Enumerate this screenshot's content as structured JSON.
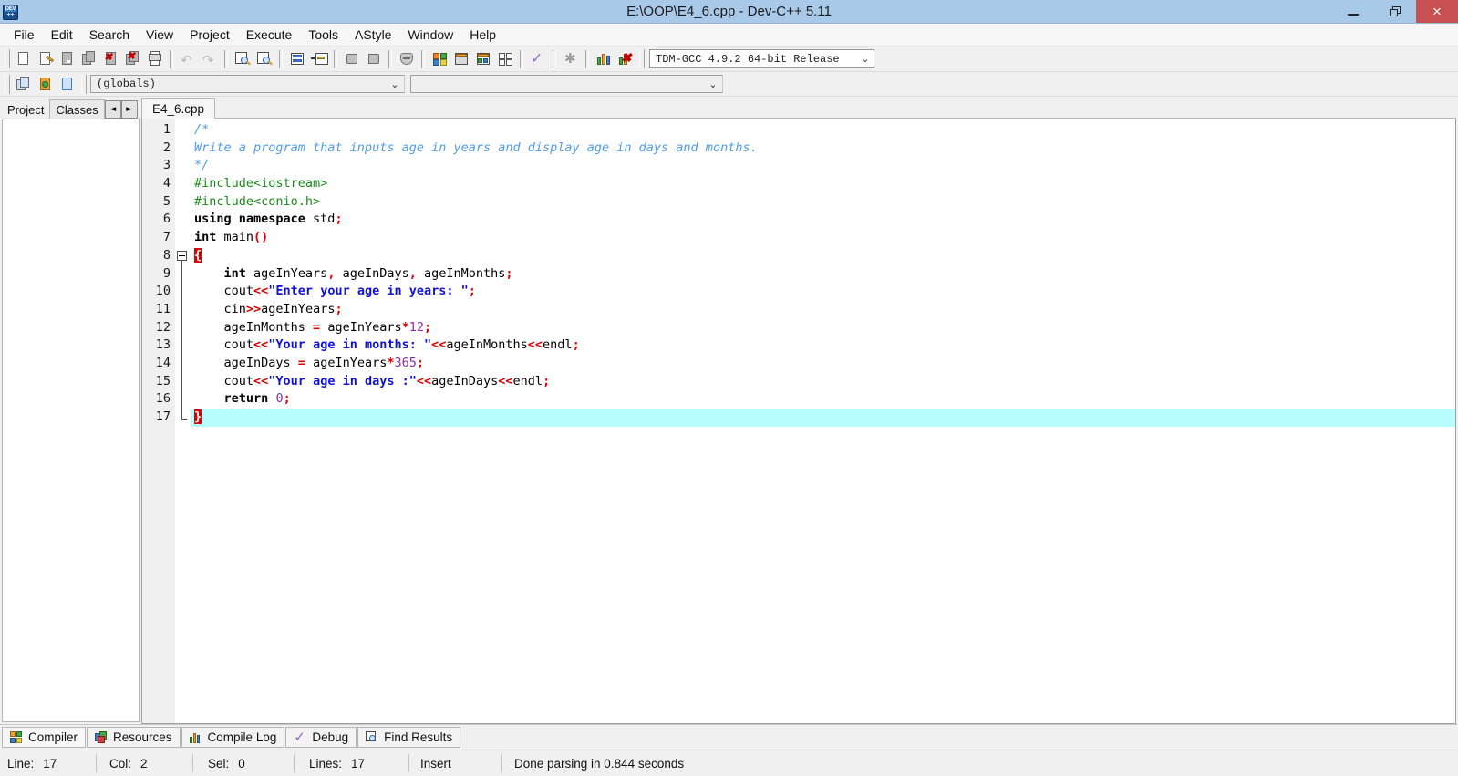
{
  "window": {
    "title": "E:\\OOP\\E4_6.cpp - Dev-C++ 5.11",
    "app_icon_top": "DEV",
    "app_icon_bottom": "++",
    "titlebar_color": "#a9c9e8",
    "close_button_color": "#c75050",
    "minimize_label": "Minimize",
    "restore_label": "Restore",
    "close_label": "×"
  },
  "menubar": {
    "items": [
      {
        "label": "File"
      },
      {
        "label": "Edit"
      },
      {
        "label": "Search"
      },
      {
        "label": "View"
      },
      {
        "label": "Project"
      },
      {
        "label": "Execute"
      },
      {
        "label": "Tools"
      },
      {
        "label": "AStyle"
      },
      {
        "label": "Window"
      },
      {
        "label": "Help"
      }
    ]
  },
  "toolbar": {
    "groups": [
      {
        "buttons": [
          {
            "icon": "new-file-icon"
          },
          {
            "icon": "open-file-icon"
          },
          {
            "icon": "save-file-icon"
          },
          {
            "icon": "save-all-icon"
          },
          {
            "icon": "close-file-icon"
          },
          {
            "icon": "close-all-icon"
          },
          {
            "icon": "print-icon"
          }
        ]
      },
      {
        "buttons": [
          {
            "icon": "undo-icon"
          },
          {
            "icon": "redo-icon"
          }
        ]
      },
      {
        "buttons": [
          {
            "icon": "find-icon"
          },
          {
            "icon": "replace-icon"
          },
          {
            "icon": "goto-line-icon"
          },
          {
            "icon": "goto-function-icon"
          }
        ]
      },
      {
        "buttons": [
          {
            "icon": "back-icon"
          },
          {
            "icon": "forward-icon"
          },
          {
            "icon": "toggle-bookmark-icon"
          }
        ]
      },
      {
        "buttons": [
          {
            "icon": "new-project-icon"
          },
          {
            "icon": "compile-icon"
          },
          {
            "icon": "run-icon"
          },
          {
            "icon": "compile-run-icon"
          },
          {
            "icon": "rebuild-all-icon"
          },
          {
            "icon": "syntax-check-icon"
          },
          {
            "icon": "stop-execution-icon"
          },
          {
            "icon": "profile-icon"
          },
          {
            "icon": "delete-profile-icon"
          }
        ]
      }
    ],
    "compiler_select": {
      "value": "TDM-GCC 4.9.2 64-bit Release",
      "arrow": "⌄"
    }
  },
  "toolbar2": {
    "buttons": [
      {
        "icon": "insert-icon"
      },
      {
        "icon": "add-to-project-icon"
      },
      {
        "icon": "toggle-panel-icon"
      }
    ],
    "scope_select": {
      "value": "(globals)",
      "arrow": "⌄"
    },
    "symbol_select": {
      "value": "",
      "arrow": "⌄"
    }
  },
  "left_panel": {
    "tabs": [
      {
        "label": "Project",
        "selected": true
      },
      {
        "label": "Classes",
        "selected": false
      }
    ],
    "scroll_left": "◄",
    "scroll_right": "►"
  },
  "editor": {
    "tabs": [
      {
        "label": "E4_6.cpp",
        "selected": true
      }
    ],
    "current_line": 17,
    "fold_start_line": 8,
    "fold_end_line": 17,
    "line_numbers": [
      1,
      2,
      3,
      4,
      5,
      6,
      7,
      8,
      9,
      10,
      11,
      12,
      13,
      14,
      15,
      16,
      17
    ],
    "lines": [
      {
        "n": 1,
        "tokens": [
          {
            "t": "/*",
            "c": "cm"
          }
        ]
      },
      {
        "n": 2,
        "tokens": [
          {
            "t": "Write a program that inputs age in years and display age in days and months.",
            "c": "cm"
          }
        ]
      },
      {
        "n": 3,
        "tokens": [
          {
            "t": "*/",
            "c": "cm"
          }
        ]
      },
      {
        "n": 4,
        "tokens": [
          {
            "t": "#include<iostream>",
            "c": "pp"
          }
        ]
      },
      {
        "n": 5,
        "tokens": [
          {
            "t": "#include<conio.h>",
            "c": "pp"
          }
        ]
      },
      {
        "n": 6,
        "tokens": [
          {
            "t": "using namespace",
            "c": "k"
          },
          {
            "t": " std",
            "c": "id"
          },
          {
            "t": ";",
            "c": "op"
          }
        ]
      },
      {
        "n": 7,
        "tokens": [
          {
            "t": "int",
            "c": "k"
          },
          {
            "t": " main",
            "c": "id"
          },
          {
            "t": "()",
            "c": "op"
          }
        ]
      },
      {
        "n": 8,
        "tokens": [
          {
            "t": "{",
            "c": "br-hl"
          }
        ]
      },
      {
        "n": 9,
        "tokens": [
          {
            "t": "    ",
            "c": "id"
          },
          {
            "t": "int",
            "c": "k"
          },
          {
            "t": " ageInYears",
            "c": "id"
          },
          {
            "t": ",",
            "c": "op"
          },
          {
            "t": " ageInDays",
            "c": "id"
          },
          {
            "t": ",",
            "c": "op"
          },
          {
            "t": " ageInMonths",
            "c": "id"
          },
          {
            "t": ";",
            "c": "op"
          }
        ]
      },
      {
        "n": 10,
        "tokens": [
          {
            "t": "    cout",
            "c": "id"
          },
          {
            "t": "<<",
            "c": "op"
          },
          {
            "t": "\"Enter your age in years: \"",
            "c": "st"
          },
          {
            "t": ";",
            "c": "op"
          }
        ]
      },
      {
        "n": 11,
        "tokens": [
          {
            "t": "    cin",
            "c": "id"
          },
          {
            "t": ">>",
            "c": "op"
          },
          {
            "t": "ageInYears",
            "c": "id"
          },
          {
            "t": ";",
            "c": "op"
          }
        ]
      },
      {
        "n": 12,
        "tokens": [
          {
            "t": "    ageInMonths ",
            "c": "id"
          },
          {
            "t": "=",
            "c": "op"
          },
          {
            "t": " ageInYears",
            "c": "id"
          },
          {
            "t": "*",
            "c": "op"
          },
          {
            "t": "12",
            "c": "nu"
          },
          {
            "t": ";",
            "c": "op"
          }
        ]
      },
      {
        "n": 13,
        "tokens": [
          {
            "t": "    cout",
            "c": "id"
          },
          {
            "t": "<<",
            "c": "op"
          },
          {
            "t": "\"Your age in months: \"",
            "c": "st"
          },
          {
            "t": "<<",
            "c": "op"
          },
          {
            "t": "ageInMonths",
            "c": "id"
          },
          {
            "t": "<<",
            "c": "op"
          },
          {
            "t": "endl",
            "c": "id"
          },
          {
            "t": ";",
            "c": "op"
          }
        ]
      },
      {
        "n": 14,
        "tokens": [
          {
            "t": "    ageInDays ",
            "c": "id"
          },
          {
            "t": "=",
            "c": "op"
          },
          {
            "t": " ageInYears",
            "c": "id"
          },
          {
            "t": "*",
            "c": "op"
          },
          {
            "t": "365",
            "c": "nu"
          },
          {
            "t": ";",
            "c": "op"
          }
        ]
      },
      {
        "n": 15,
        "tokens": [
          {
            "t": "    cout",
            "c": "id"
          },
          {
            "t": "<<",
            "c": "op"
          },
          {
            "t": "\"Your age in days :\"",
            "c": "st"
          },
          {
            "t": "<<",
            "c": "op"
          },
          {
            "t": "ageInDays",
            "c": "id"
          },
          {
            "t": "<<",
            "c": "op"
          },
          {
            "t": "endl",
            "c": "id"
          },
          {
            "t": ";",
            "c": "op"
          }
        ]
      },
      {
        "n": 16,
        "tokens": [
          {
            "t": "    ",
            "c": "id"
          },
          {
            "t": "return",
            "c": "k"
          },
          {
            "t": " ",
            "c": "id"
          },
          {
            "t": "0",
            "c": "nu"
          },
          {
            "t": ";",
            "c": "op"
          }
        ]
      },
      {
        "n": 17,
        "tokens": [
          {
            "t": "}",
            "c": "br-hl"
          }
        ]
      }
    ]
  },
  "bottom_tabs": [
    {
      "label": "Compiler",
      "icon": "compiler-icon",
      "selected": true
    },
    {
      "label": "Resources",
      "icon": "resources-icon",
      "selected": false
    },
    {
      "label": "Compile Log",
      "icon": "compile-log-icon",
      "selected": false
    },
    {
      "label": "Debug",
      "icon": "debug-icon",
      "selected": false
    },
    {
      "label": "Find Results",
      "icon": "find-results-icon",
      "selected": false
    }
  ],
  "statusbar": {
    "line_label": "Line:",
    "line_value": "17",
    "col_label": "Col:",
    "col_value": "2",
    "sel_label": "Sel:",
    "sel_value": "0",
    "lines_label": "Lines:",
    "lines_value": "17",
    "insert_mode": "Insert",
    "message": "Done parsing in 0.844 seconds"
  }
}
